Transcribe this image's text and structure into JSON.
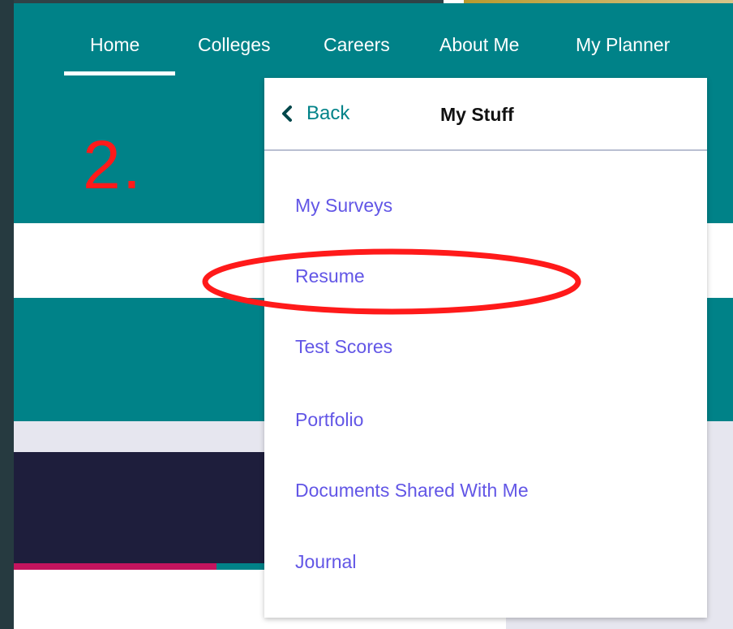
{
  "nav": {
    "items": [
      "Home",
      "Colleges",
      "Careers",
      "About Me",
      "My Planner"
    ],
    "active": "Home"
  },
  "annotation": {
    "step_label": "2."
  },
  "dropdown": {
    "back_label": "Back",
    "title": "My Stuff",
    "items": [
      "My Surveys",
      "Resume",
      "Test Scores",
      "Portfolio",
      "Documents Shared With Me",
      "Journal"
    ],
    "highlighted_item": "Resume"
  },
  "colors": {
    "teal": "#008288",
    "link": "#6256e6",
    "annotation_red": "#ff1a1a",
    "navy": "#1e1e3c",
    "pink_accent": "#c4145e"
  },
  "icons": {
    "back": "chevron-left-icon"
  }
}
